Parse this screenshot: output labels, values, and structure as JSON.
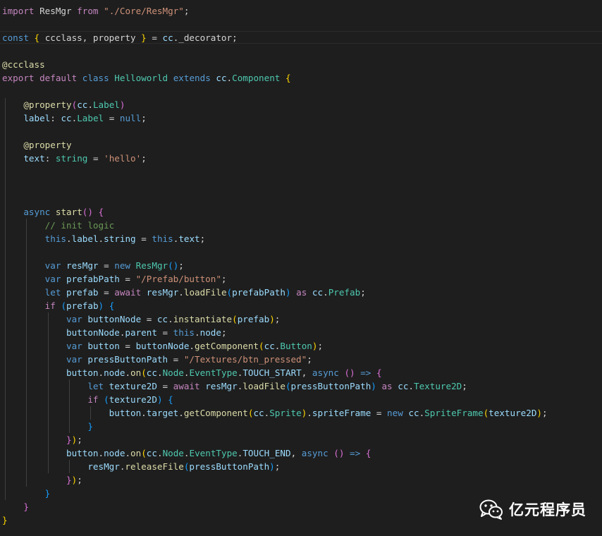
{
  "editor": {
    "theme_colors": {
      "background": "#1e1e1e",
      "keyword": "#569cd6",
      "control": "#c586c0",
      "string": "#ce9178",
      "class": "#4ec9b0",
      "function": "#dcdcaa",
      "variable": "#9cdcfe",
      "comment": "#6a9955",
      "text": "#d4d4d4"
    },
    "lines": [
      [
        [
          "ctl",
          "import"
        ],
        [
          "txt",
          " ResMgr "
        ],
        [
          "ctl",
          "from"
        ],
        [
          "txt",
          " "
        ],
        [
          "str",
          "\"./Core/ResMgr\""
        ],
        [
          "txt",
          ";"
        ]
      ],
      [],
      [
        [
          "kw",
          "const"
        ],
        [
          "txt",
          " "
        ],
        [
          "b1",
          "{"
        ],
        [
          "txt",
          " ccclass, property "
        ],
        [
          "b1",
          "}"
        ],
        [
          "txt",
          " = "
        ],
        [
          "var",
          "cc"
        ],
        [
          "txt",
          "._decorator;"
        ]
      ],
      [],
      [
        [
          "fn",
          "@ccclass"
        ]
      ],
      [
        [
          "ctl",
          "export"
        ],
        [
          "txt",
          " "
        ],
        [
          "ctl",
          "default"
        ],
        [
          "txt",
          " "
        ],
        [
          "kw",
          "class"
        ],
        [
          "txt",
          " "
        ],
        [
          "cls",
          "Helloworld"
        ],
        [
          "txt",
          " "
        ],
        [
          "kw",
          "extends"
        ],
        [
          "txt",
          " "
        ],
        [
          "var",
          "cc"
        ],
        [
          "txt",
          "."
        ],
        [
          "cls",
          "Component"
        ],
        [
          "txt",
          " "
        ],
        [
          "b1",
          "{"
        ]
      ],
      [],
      [
        [
          "txt",
          "    "
        ],
        [
          "fn",
          "@property"
        ],
        [
          "b2",
          "("
        ],
        [
          "var",
          "cc"
        ],
        [
          "txt",
          "."
        ],
        [
          "cls",
          "Label"
        ],
        [
          "b2",
          ")"
        ]
      ],
      [
        [
          "txt",
          "    "
        ],
        [
          "var",
          "label"
        ],
        [
          "txt",
          ": "
        ],
        [
          "var",
          "cc"
        ],
        [
          "txt",
          "."
        ],
        [
          "cls",
          "Label"
        ],
        [
          "txt",
          " = "
        ],
        [
          "kw",
          "null"
        ],
        [
          "txt",
          ";"
        ]
      ],
      [],
      [
        [
          "txt",
          "    "
        ],
        [
          "fn",
          "@property"
        ]
      ],
      [
        [
          "txt",
          "    "
        ],
        [
          "var",
          "text"
        ],
        [
          "txt",
          ": "
        ],
        [
          "cls",
          "string"
        ],
        [
          "txt",
          " = "
        ],
        [
          "str",
          "'hello'"
        ],
        [
          "txt",
          ";"
        ]
      ],
      [],
      [],
      [],
      [
        [
          "txt",
          "    "
        ],
        [
          "kw",
          "async"
        ],
        [
          "txt",
          " "
        ],
        [
          "fn",
          "start"
        ],
        [
          "b2",
          "()"
        ],
        [
          "txt",
          " "
        ],
        [
          "b2",
          "{"
        ]
      ],
      [
        [
          "txt",
          "        "
        ],
        [
          "com",
          "// init logic"
        ]
      ],
      [
        [
          "txt",
          "        "
        ],
        [
          "kw",
          "this"
        ],
        [
          "txt",
          "."
        ],
        [
          "var",
          "label"
        ],
        [
          "txt",
          "."
        ],
        [
          "var",
          "string"
        ],
        [
          "txt",
          " = "
        ],
        [
          "kw",
          "this"
        ],
        [
          "txt",
          "."
        ],
        [
          "var",
          "text"
        ],
        [
          "txt",
          ";"
        ]
      ],
      [],
      [
        [
          "txt",
          "        "
        ],
        [
          "kw",
          "var"
        ],
        [
          "txt",
          " "
        ],
        [
          "var",
          "resMgr"
        ],
        [
          "txt",
          " = "
        ],
        [
          "kw",
          "new"
        ],
        [
          "txt",
          " "
        ],
        [
          "cls",
          "ResMgr"
        ],
        [
          "b3",
          "()"
        ],
        [
          "txt",
          ";"
        ]
      ],
      [
        [
          "txt",
          "        "
        ],
        [
          "kw",
          "var"
        ],
        [
          "txt",
          " "
        ],
        [
          "var",
          "prefabPath"
        ],
        [
          "txt",
          " = "
        ],
        [
          "str",
          "\"/Prefab/button\""
        ],
        [
          "txt",
          ";"
        ]
      ],
      [
        [
          "txt",
          "        "
        ],
        [
          "kw",
          "let"
        ],
        [
          "txt",
          " "
        ],
        [
          "var",
          "prefab"
        ],
        [
          "txt",
          " = "
        ],
        [
          "ctl",
          "await"
        ],
        [
          "txt",
          " "
        ],
        [
          "var",
          "resMgr"
        ],
        [
          "txt",
          "."
        ],
        [
          "fn",
          "loadFile"
        ],
        [
          "b3",
          "("
        ],
        [
          "var",
          "prefabPath"
        ],
        [
          "b3",
          ")"
        ],
        [
          "txt",
          " "
        ],
        [
          "ctl",
          "as"
        ],
        [
          "txt",
          " "
        ],
        [
          "var",
          "cc"
        ],
        [
          "txt",
          "."
        ],
        [
          "cls",
          "Prefab"
        ],
        [
          "txt",
          ";"
        ]
      ],
      [
        [
          "txt",
          "        "
        ],
        [
          "ctl",
          "if"
        ],
        [
          "txt",
          " "
        ],
        [
          "b3",
          "("
        ],
        [
          "var",
          "prefab"
        ],
        [
          "b3",
          ")"
        ],
        [
          "txt",
          " "
        ],
        [
          "b3",
          "{"
        ]
      ],
      [
        [
          "txt",
          "            "
        ],
        [
          "kw",
          "var"
        ],
        [
          "txt",
          " "
        ],
        [
          "var",
          "buttonNode"
        ],
        [
          "txt",
          " = "
        ],
        [
          "var",
          "cc"
        ],
        [
          "txt",
          "."
        ],
        [
          "fn",
          "instantiate"
        ],
        [
          "b1",
          "("
        ],
        [
          "var",
          "prefab"
        ],
        [
          "b1",
          ")"
        ],
        [
          "txt",
          ";"
        ]
      ],
      [
        [
          "txt",
          "            "
        ],
        [
          "var",
          "buttonNode"
        ],
        [
          "txt",
          "."
        ],
        [
          "var",
          "parent"
        ],
        [
          "txt",
          " = "
        ],
        [
          "kw",
          "this"
        ],
        [
          "txt",
          "."
        ],
        [
          "var",
          "node"
        ],
        [
          "txt",
          ";"
        ]
      ],
      [
        [
          "txt",
          "            "
        ],
        [
          "kw",
          "var"
        ],
        [
          "txt",
          " "
        ],
        [
          "var",
          "button"
        ],
        [
          "txt",
          " = "
        ],
        [
          "var",
          "buttonNode"
        ],
        [
          "txt",
          "."
        ],
        [
          "fn",
          "getComponent"
        ],
        [
          "b1",
          "("
        ],
        [
          "var",
          "cc"
        ],
        [
          "txt",
          "."
        ],
        [
          "cls",
          "Button"
        ],
        [
          "b1",
          ")"
        ],
        [
          "txt",
          ";"
        ]
      ],
      [
        [
          "txt",
          "            "
        ],
        [
          "kw",
          "var"
        ],
        [
          "txt",
          " "
        ],
        [
          "var",
          "pressButtonPath"
        ],
        [
          "txt",
          " = "
        ],
        [
          "str",
          "\"/Textures/btn_pressed\""
        ],
        [
          "txt",
          ";"
        ]
      ],
      [
        [
          "txt",
          "            "
        ],
        [
          "var",
          "button"
        ],
        [
          "txt",
          "."
        ],
        [
          "var",
          "node"
        ],
        [
          "txt",
          "."
        ],
        [
          "fn",
          "on"
        ],
        [
          "b1",
          "("
        ],
        [
          "var",
          "cc"
        ],
        [
          "txt",
          "."
        ],
        [
          "cls",
          "Node"
        ],
        [
          "txt",
          "."
        ],
        [
          "cls",
          "EventType"
        ],
        [
          "txt",
          "."
        ],
        [
          "var",
          "TOUCH_START"
        ],
        [
          "txt",
          ", "
        ],
        [
          "kw",
          "async"
        ],
        [
          "txt",
          " "
        ],
        [
          "b2",
          "()"
        ],
        [
          "txt",
          " "
        ],
        [
          "kw",
          "=>"
        ],
        [
          "txt",
          " "
        ],
        [
          "b2",
          "{"
        ]
      ],
      [
        [
          "txt",
          "                "
        ],
        [
          "kw",
          "let"
        ],
        [
          "txt",
          " "
        ],
        [
          "var",
          "texture2D"
        ],
        [
          "txt",
          " = "
        ],
        [
          "ctl",
          "await"
        ],
        [
          "txt",
          " "
        ],
        [
          "var",
          "resMgr"
        ],
        [
          "txt",
          "."
        ],
        [
          "fn",
          "loadFile"
        ],
        [
          "b3",
          "("
        ],
        [
          "var",
          "pressButtonPath"
        ],
        [
          "b3",
          ")"
        ],
        [
          "txt",
          " "
        ],
        [
          "ctl",
          "as"
        ],
        [
          "txt",
          " "
        ],
        [
          "var",
          "cc"
        ],
        [
          "txt",
          "."
        ],
        [
          "cls",
          "Texture2D"
        ],
        [
          "txt",
          ";"
        ]
      ],
      [
        [
          "txt",
          "                "
        ],
        [
          "ctl",
          "if"
        ],
        [
          "txt",
          " "
        ],
        [
          "b3",
          "("
        ],
        [
          "var",
          "texture2D"
        ],
        [
          "b3",
          ")"
        ],
        [
          "txt",
          " "
        ],
        [
          "b3",
          "{"
        ]
      ],
      [
        [
          "txt",
          "                    "
        ],
        [
          "var",
          "button"
        ],
        [
          "txt",
          "."
        ],
        [
          "var",
          "target"
        ],
        [
          "txt",
          "."
        ],
        [
          "fn",
          "getComponent"
        ],
        [
          "b1",
          "("
        ],
        [
          "var",
          "cc"
        ],
        [
          "txt",
          "."
        ],
        [
          "cls",
          "Sprite"
        ],
        [
          "b1",
          ")"
        ],
        [
          "txt",
          "."
        ],
        [
          "var",
          "spriteFrame"
        ],
        [
          "txt",
          " = "
        ],
        [
          "kw",
          "new"
        ],
        [
          "txt",
          " "
        ],
        [
          "var",
          "cc"
        ],
        [
          "txt",
          "."
        ],
        [
          "cls",
          "SpriteFrame"
        ],
        [
          "b1",
          "("
        ],
        [
          "var",
          "texture2D"
        ],
        [
          "b1",
          ")"
        ],
        [
          "txt",
          ";"
        ]
      ],
      [
        [
          "txt",
          "                "
        ],
        [
          "b3",
          "}"
        ]
      ],
      [
        [
          "txt",
          "            "
        ],
        [
          "b2",
          "}"
        ],
        [
          "b1",
          ")"
        ],
        [
          "txt",
          ";"
        ]
      ],
      [
        [
          "txt",
          "            "
        ],
        [
          "var",
          "button"
        ],
        [
          "txt",
          "."
        ],
        [
          "var",
          "node"
        ],
        [
          "txt",
          "."
        ],
        [
          "fn",
          "on"
        ],
        [
          "b1",
          "("
        ],
        [
          "var",
          "cc"
        ],
        [
          "txt",
          "."
        ],
        [
          "cls",
          "Node"
        ],
        [
          "txt",
          "."
        ],
        [
          "cls",
          "EventType"
        ],
        [
          "txt",
          "."
        ],
        [
          "var",
          "TOUCH_END"
        ],
        [
          "txt",
          ", "
        ],
        [
          "kw",
          "async"
        ],
        [
          "txt",
          " "
        ],
        [
          "b2",
          "()"
        ],
        [
          "txt",
          " "
        ],
        [
          "kw",
          "=>"
        ],
        [
          "txt",
          " "
        ],
        [
          "b2",
          "{"
        ]
      ],
      [
        [
          "txt",
          "                "
        ],
        [
          "var",
          "resMgr"
        ],
        [
          "txt",
          "."
        ],
        [
          "fn",
          "releaseFile"
        ],
        [
          "b3",
          "("
        ],
        [
          "var",
          "pressButtonPath"
        ],
        [
          "b3",
          ")"
        ],
        [
          "txt",
          ";"
        ]
      ],
      [
        [
          "txt",
          "            "
        ],
        [
          "b2",
          "}"
        ],
        [
          "b1",
          ")"
        ],
        [
          "txt",
          ";"
        ]
      ],
      [
        [
          "txt",
          "        "
        ],
        [
          "b3",
          "}"
        ]
      ],
      [
        [
          "txt",
          "    "
        ],
        [
          "b2",
          "}"
        ]
      ],
      [
        [
          "b1",
          "}"
        ]
      ]
    ]
  },
  "watermark": {
    "icon": "wechat-icon",
    "text": "亿元程序员"
  }
}
